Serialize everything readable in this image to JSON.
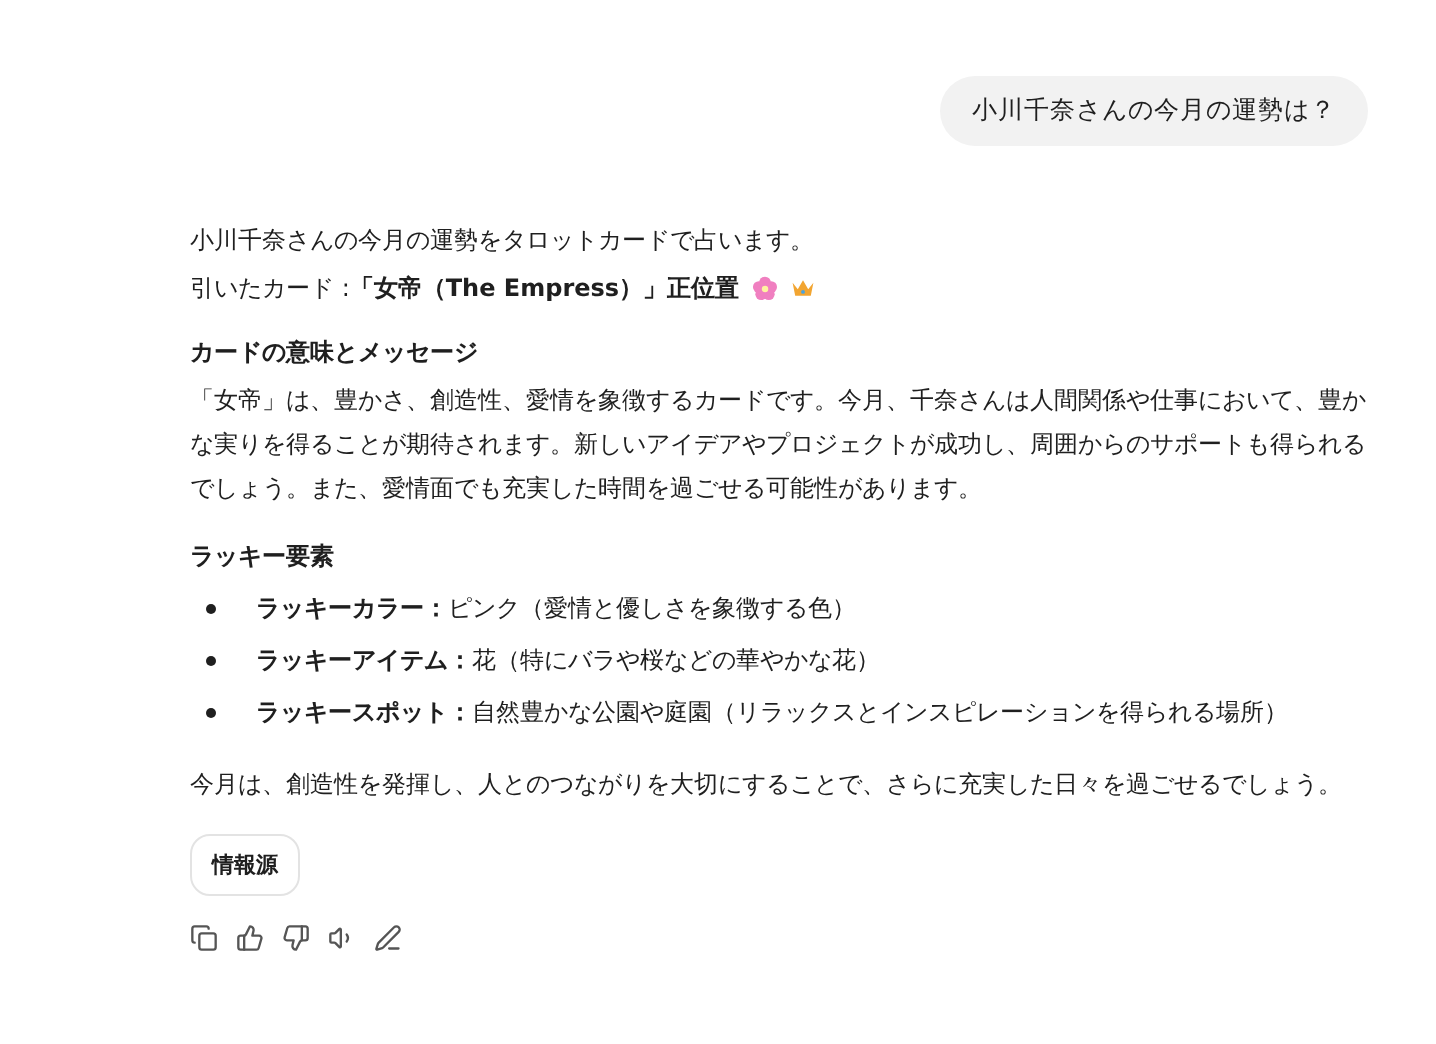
{
  "user_message": "小川千奈さんの今月の運勢は？",
  "reply": {
    "intro": "小川千奈さんの今月の運勢をタロットカードで占います。",
    "card_line": "引いたカード :**「女帝（The Empress）」正位置**",
    "meaning_heading": "カードの意味とメッセージ",
    "meaning": "「女帝」は、豊かさ、創造性、愛情を象徴するカードです。今月、千奈さんは人間関係や仕事において、豊かな実りを得ることが期待されます。新しいアイデアやプロジェクトが成功し、周囲からのサポートも得られるでしょう。また、愛情面でも充実した時間を過ごせる可能性があります。",
    "lucky_heading": "ラッキー要素",
    "lucky_items": [
      {
        "label": "ラッキーカラー：",
        "text": "ピンク（愛情と優しさを象徴する色）"
      },
      {
        "label": "ラッキーアイテム：",
        "text": "花（特にバラや桜などの華やかな花）"
      },
      {
        "label": "ラッキースポット：",
        "text": "自然豊かな公園や庭園（リラックスとインスピレーションを得られる場所）"
      }
    ],
    "closing": "今月は、創造性を発揮し、人とのつながりを大切にすることで、さらに充実した日々を過ごせるでしょう。",
    "sources_button": "情報源"
  }
}
